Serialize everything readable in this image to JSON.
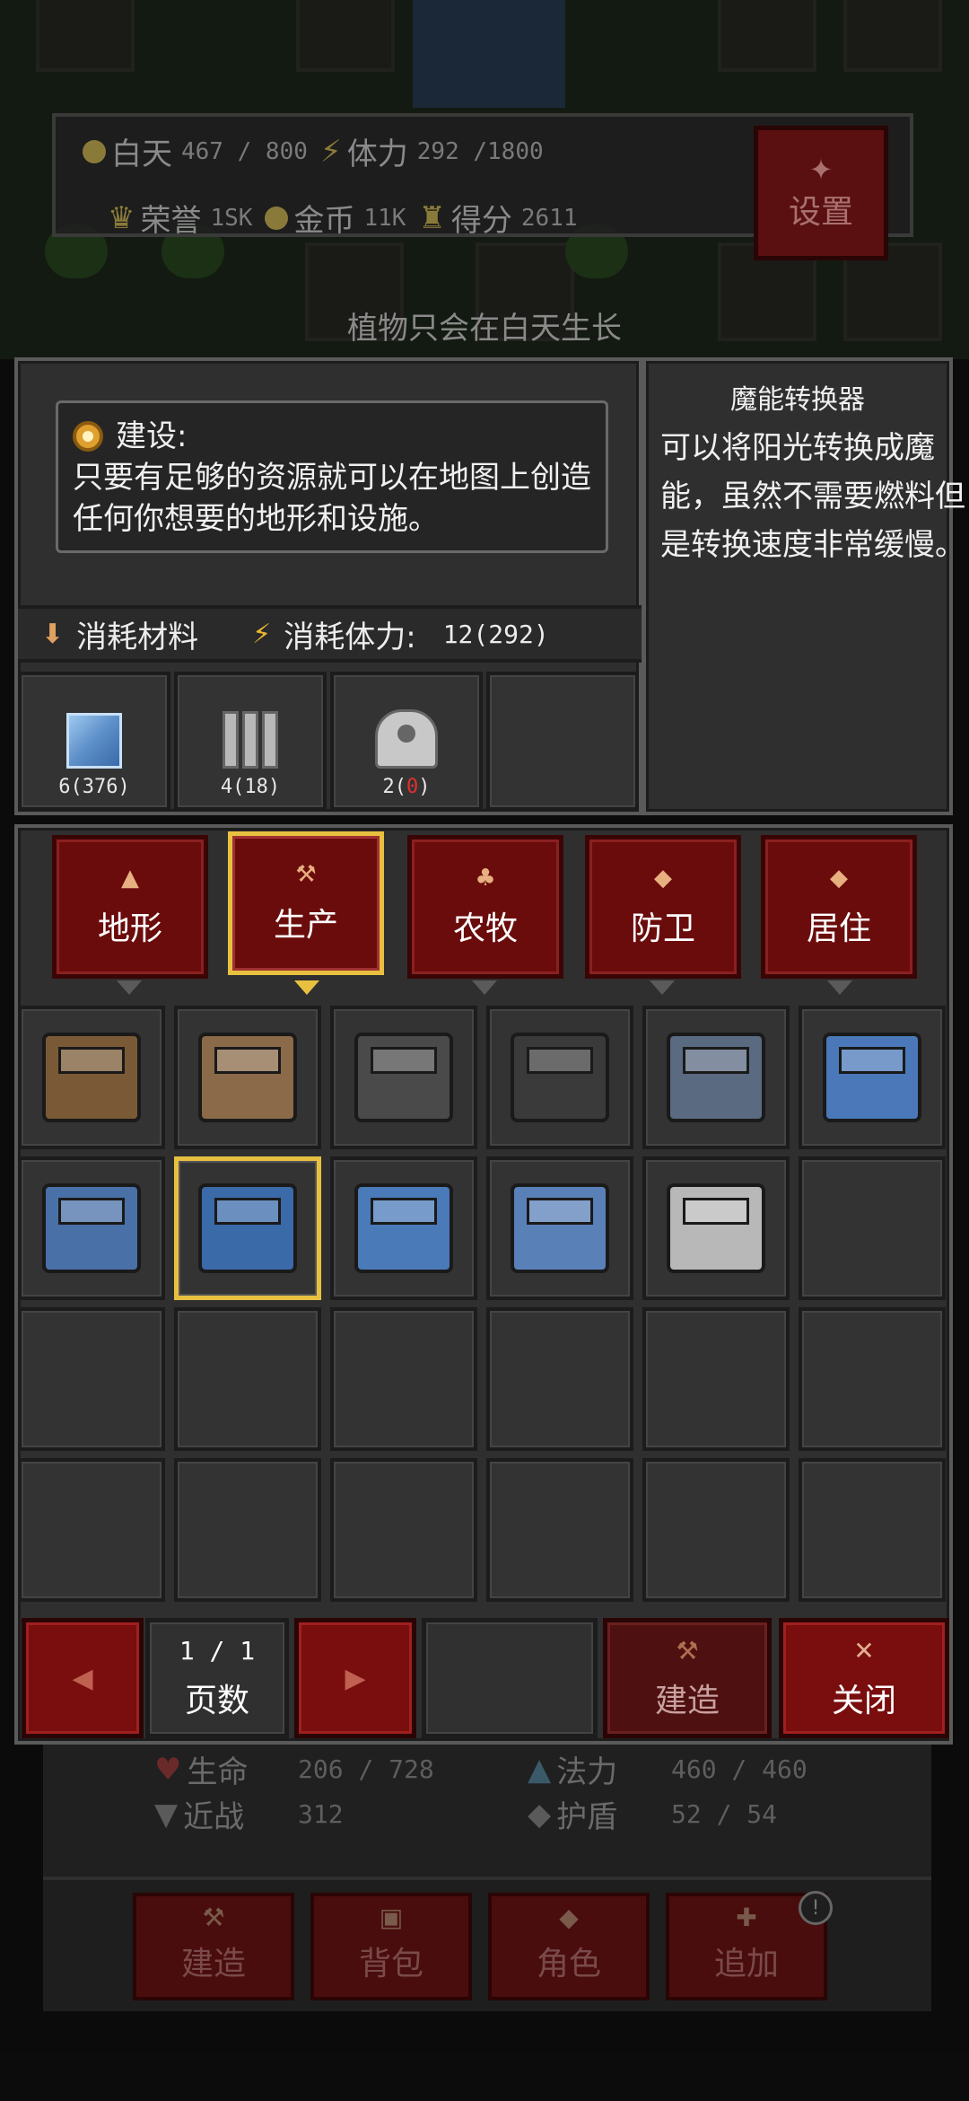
{
  "hud": {
    "daytime_label": "白天",
    "daytime_value": "467 / 800",
    "stamina_label": "体力",
    "stamina_value": "292 /1800",
    "honor_label": "荣誉",
    "honor_value": "1SK",
    "gold_label": "金币",
    "gold_value": "11K",
    "score_label": "得分",
    "score_value": "2611",
    "settings_label": "设置",
    "notice": "植物只会在白天生长"
  },
  "build_panel": {
    "desc_title": "建设:",
    "desc_text": "只要有足够的资源就可以在地图上创造任何你想要的地形和设施。",
    "materials_label": "消耗材料",
    "stamina_cost_label": "消耗体力:",
    "stamina_cost_value": "12(292)",
    "materials": [
      {
        "icon": "glass-block",
        "qty_have": "6(376)"
      },
      {
        "icon": "metal-pillar",
        "qty_have": "4(18)"
      },
      {
        "icon": "pipe-fitting",
        "qty_have_prefix": "2(",
        "qty_missing": "0",
        "qty_have_suffix": ")"
      }
    ]
  },
  "info": {
    "title": "魔能转换器",
    "text": "可以将阳光转换成魔能，虽然不需要燃料但是转换速度非常缓慢。"
  },
  "tabs": [
    {
      "label": "地形",
      "icon": "terrain-icon",
      "active": false
    },
    {
      "label": "生产",
      "icon": "anvil-icon",
      "active": true
    },
    {
      "label": "农牧",
      "icon": "sprout-icon",
      "active": false
    },
    {
      "label": "防卫",
      "icon": "shield-icon",
      "active": false
    },
    {
      "label": "居住",
      "icon": "house-icon",
      "active": false
    }
  ],
  "buildings": [
    {
      "name": "workbench",
      "color": "#7a5a36"
    },
    {
      "name": "cooking-station",
      "color": "#8a6a48"
    },
    {
      "name": "furnace",
      "color": "#4a4a4a"
    },
    {
      "name": "anvil",
      "color": "#3a3a3a"
    },
    {
      "name": "refinery",
      "color": "#5a6a80"
    },
    {
      "name": "storage-machine",
      "color": "#4a78b8"
    },
    {
      "name": "grinder",
      "color": "#4a70a8"
    },
    {
      "name": "magic-converter",
      "color": "#3a6aa8",
      "selected": true
    },
    {
      "name": "loom",
      "color": "#4a7ab8"
    },
    {
      "name": "twin-tank",
      "color": "#5a80b8"
    },
    {
      "name": "distiller",
      "color": "#b8b8b8"
    }
  ],
  "controls": {
    "page_current": "1",
    "page_total": "1",
    "page_text": "1 / 1",
    "page_label": "页数",
    "build_label": "建造",
    "close_label": "关闭"
  },
  "stats": {
    "hp_label": "生命",
    "hp_value": "206 / 728",
    "mp_label": "法力",
    "mp_value": "460 / 460",
    "melee_label": "近战",
    "melee_value": "312",
    "shield_label": "护盾",
    "shield_value": "52 / 54"
  },
  "nav": [
    {
      "label": "建造"
    },
    {
      "label": "背包"
    },
    {
      "label": "角色"
    },
    {
      "label": "追加"
    }
  ],
  "colors": {
    "accent_gold": "#e8c040",
    "button_red": "#7a0d0d",
    "missing_red": "#e23030"
  }
}
